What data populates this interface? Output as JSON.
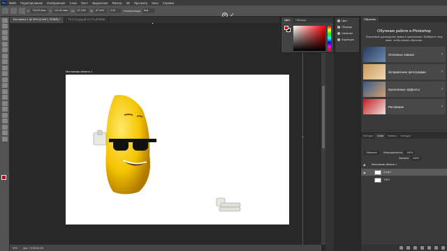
{
  "app": {
    "logo": "Ps"
  },
  "menu": [
    "Файл",
    "Редактирование",
    "Изображение",
    "Слои",
    "Текст",
    "Выделение",
    "Фильтр",
    "3D",
    "Просмотр",
    "Окно",
    "Справка"
  ],
  "options": {
    "x_label": "X:",
    "x_value": "718,09 пикс",
    "y_label": "Y:",
    "y_value": "121,00 пикс",
    "w_label": "Ш:",
    "w_value": "87,19%",
    "h_label": "В:",
    "h_value": "87,19%",
    "angle_value": "0,00",
    "interp_label": "Интерполяция:",
    "interp_value": "Бик"
  },
  "document_tabs": [
    "Без имени-1 @ 50% (Слой 1, RGB/8) *",
    "TNT2 (1).jpg @ 16,7% (RGB/8)"
  ],
  "canvas": {
    "artboard_label": "Монтажная область 1"
  },
  "status": {
    "zoom": "50%",
    "doc": "Док: 7,91М/10,3М"
  },
  "color_panel": {
    "tabs": [
      "Цвет",
      "Образцы"
    ]
  },
  "mini_panel": {
    "items": [
      "Цвет",
      "Образцы",
      "Свойства",
      "Коррекция"
    ]
  },
  "learn_panel": {
    "tab": "Обучение",
    "title": "Обучение работе в Photoshop",
    "subtitle": "Пошаговые руководства прямо в приложении. Выберите тему ниже, чтобы начать обучение.",
    "cards": [
      "Основные навыки",
      "Исправление фотографии",
      "Креативные эффекты",
      "Рисование"
    ]
  },
  "layers_panel": {
    "tabs": [
      "Контуры",
      "Слои",
      "Каналы",
      "Контуры"
    ],
    "blend_mode": "Обычные",
    "opacity_label": "Непрозрачность:",
    "opacity_value": "100%",
    "fill_label": "Заливка:",
    "fill_value": "100%",
    "layers": [
      "Монтажная область 1",
      "Слой 1",
      "TNT2"
    ]
  }
}
